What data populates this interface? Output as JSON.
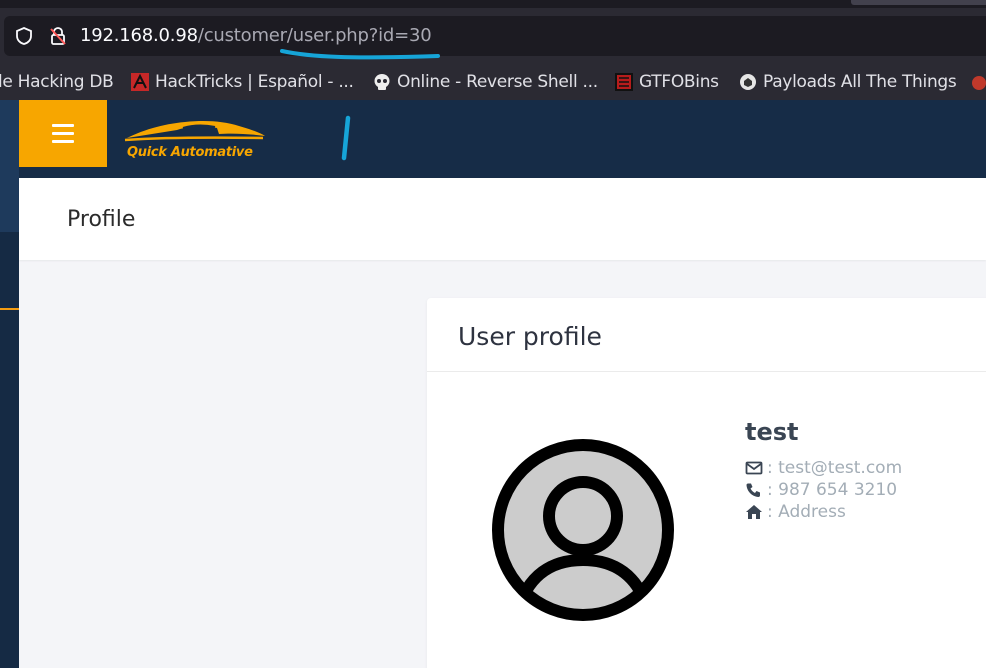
{
  "browser": {
    "url_host": "192.168.0.98",
    "url_path": "/customer/user.php?id=30",
    "bookmarks": [
      {
        "label": "le Hacking DB",
        "icon": "none"
      },
      {
        "label": "HackTricks | Español - ...",
        "icon": "hacktricks-icon"
      },
      {
        "label": "Online - Reverse Shell ...",
        "icon": "skull-icon"
      },
      {
        "label": "GTFOBins",
        "icon": "gtfobins-icon"
      },
      {
        "label": "Payloads All The Things",
        "icon": "payloads-icon"
      }
    ]
  },
  "app": {
    "logo_text": "Quick Automative",
    "page_title": "Profile"
  },
  "profile": {
    "card_title": "User profile",
    "name": "test",
    "email": ": test@test.com",
    "phone": ": 987 654 3210",
    "address": ": Address"
  },
  "colors": {
    "accent": "#f7a600",
    "navbar": "#162c47",
    "annotation": "#16a5d8"
  }
}
